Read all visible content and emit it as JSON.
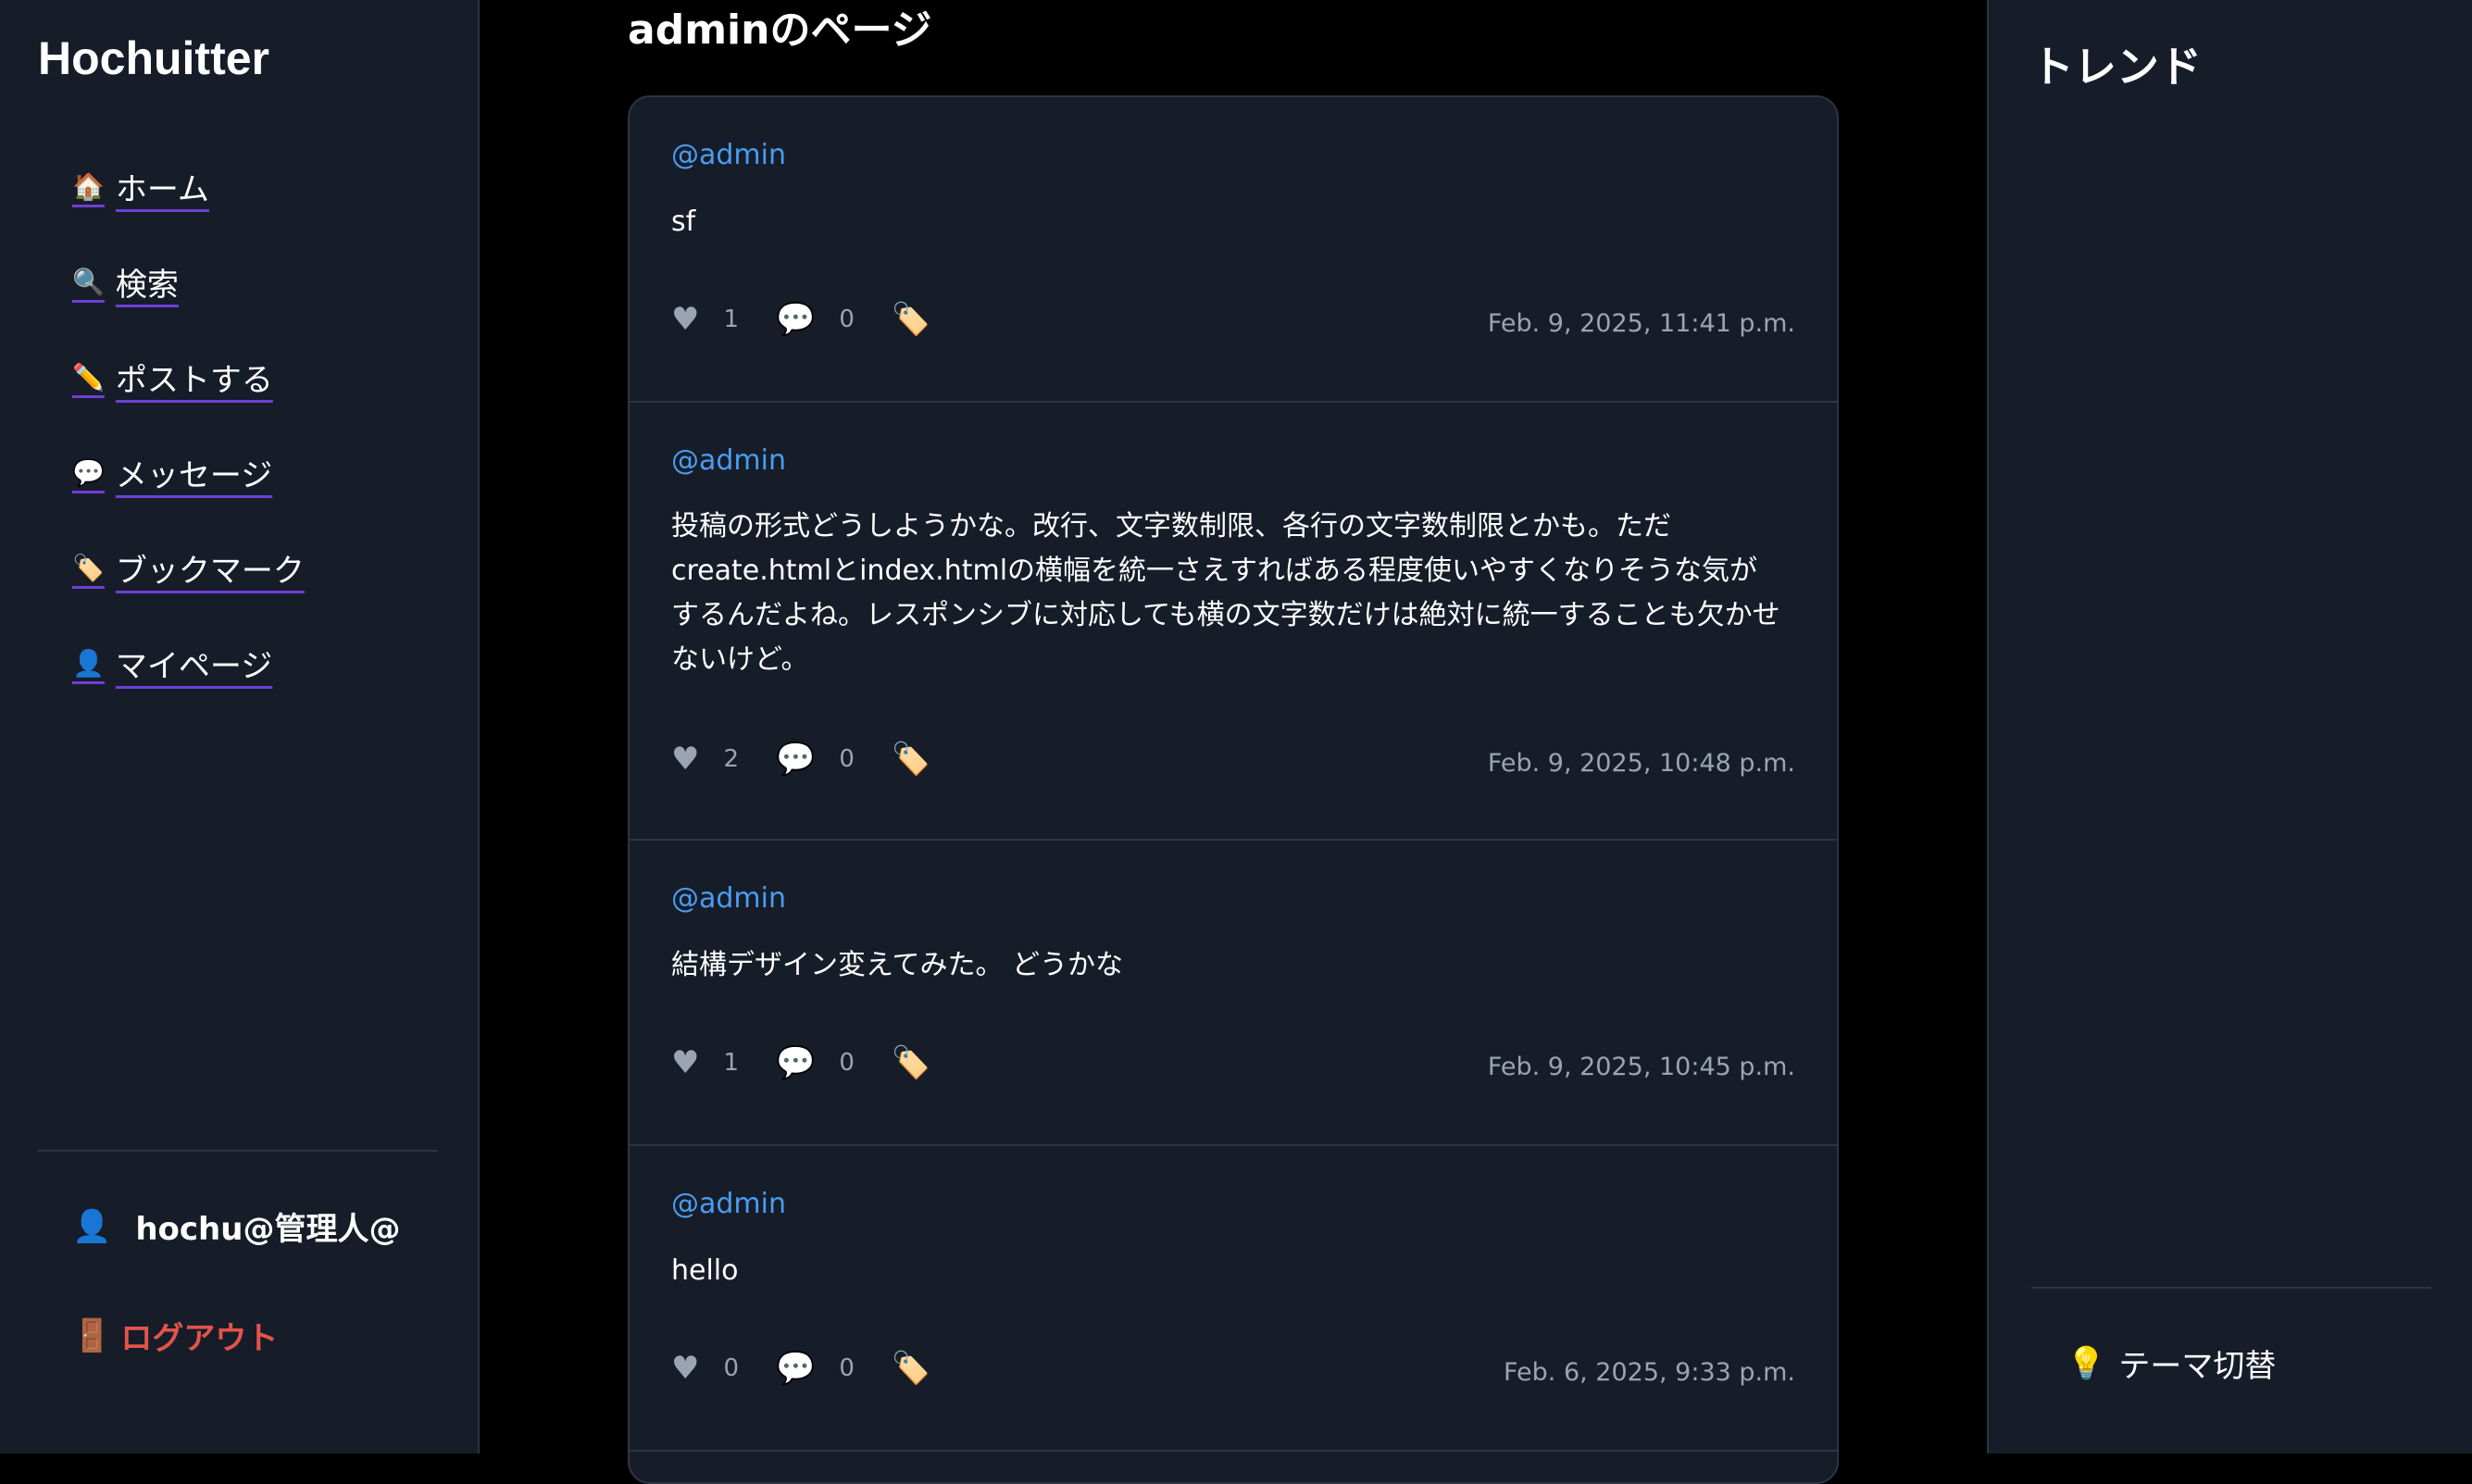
{
  "app": {
    "brand": "Hochuitter"
  },
  "sidebar": {
    "items": [
      {
        "icon": "🏠",
        "label": "ホーム"
      },
      {
        "icon": "🔍",
        "label": "検索"
      },
      {
        "icon": "✏️",
        "label": "ポストする"
      },
      {
        "icon": "💬",
        "label": "メッセージ"
      },
      {
        "icon": "🏷️",
        "label": "ブックマーク"
      },
      {
        "icon": "👤",
        "label": "マイページ"
      }
    ],
    "user": {
      "icon": "👤",
      "name": "hochu@管理人@"
    },
    "logout": {
      "icon": "🚪",
      "label": "ログアウト"
    }
  },
  "main": {
    "title": "adminのページ",
    "posts": [
      {
        "author": "@admin",
        "body": "sf",
        "likes": "1",
        "comments": "0",
        "timestamp": "Feb. 9, 2025, 11:41 p.m."
      },
      {
        "author": "@admin",
        "body": "投稿の形式どうしようかな。改行、文字数制限、各行の文字数制限とかも。ただcreate.htmlとindex.htmlの横幅を統一さえすればある程度使いやすくなりそうな気がするんだよね。レスポンシブに対応しても横の文字数だけは絶対に統一することも欠かせないけど。",
        "likes": "2",
        "comments": "0",
        "timestamp": "Feb. 9, 2025, 10:48 p.m."
      },
      {
        "author": "@admin",
        "body": "結構デザイン変えてみた。 どうかな",
        "likes": "1",
        "comments": "0",
        "timestamp": "Feb. 9, 2025, 10:45 p.m."
      },
      {
        "author": "@admin",
        "body": "hello",
        "likes": "0",
        "comments": "0",
        "timestamp": "Feb. 6, 2025, 9:33 p.m."
      }
    ]
  },
  "right": {
    "title": "トレンド",
    "theme_toggle": {
      "icon": "💡",
      "label": "テーマ切替"
    }
  },
  "icons": {
    "like": "♥",
    "comment": "💬",
    "bookmark": "🏷️"
  },
  "colors": {
    "background": "#000000",
    "panel": "#161d29",
    "border": "#2b3442",
    "link": "#4a9cf0",
    "logout": "#e5534b",
    "underline": "#6e3fd6"
  }
}
